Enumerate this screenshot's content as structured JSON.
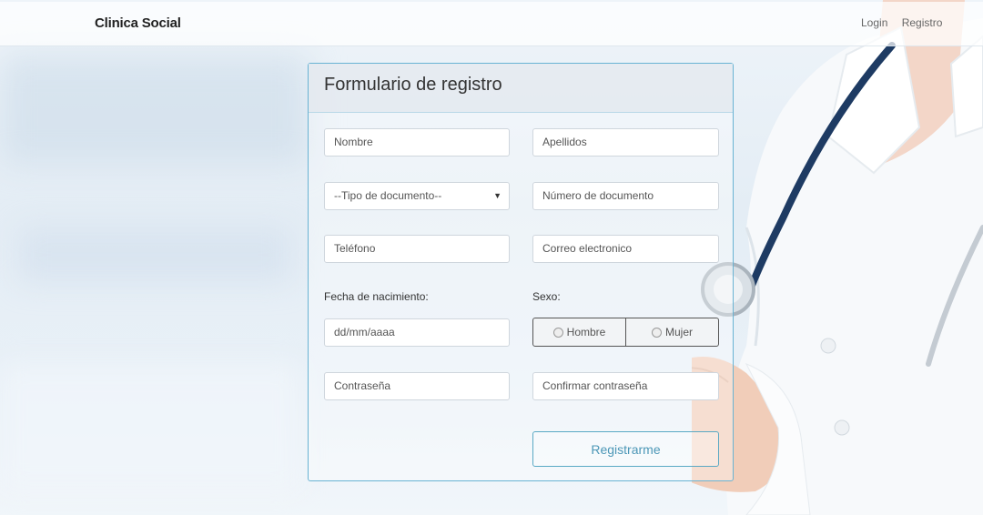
{
  "navbar": {
    "brand": "Clinica Social",
    "links": [
      "Login",
      "Registro"
    ]
  },
  "form": {
    "title": "Formulario de registro",
    "fields": {
      "nombre": "Nombre",
      "apellidos": "Apellidos",
      "tipo_documento": "--Tipo de documento--",
      "numero_documento": "Número de documento",
      "telefono": "Teléfono",
      "correo": "Correo electronico",
      "fecha_label": "Fecha de nacimiento:",
      "fecha_placeholder": "dd/mm/aaaa",
      "sexo_label": "Sexo:",
      "sexo_options": [
        "Hombre",
        "Mujer"
      ],
      "contrasena": "Contraseña",
      "confirmar": "Confirmar contraseña"
    },
    "submit_label": "Registrarme"
  },
  "colors": {
    "accent": "#4c97b7",
    "panel_border": "#69b3d3"
  }
}
